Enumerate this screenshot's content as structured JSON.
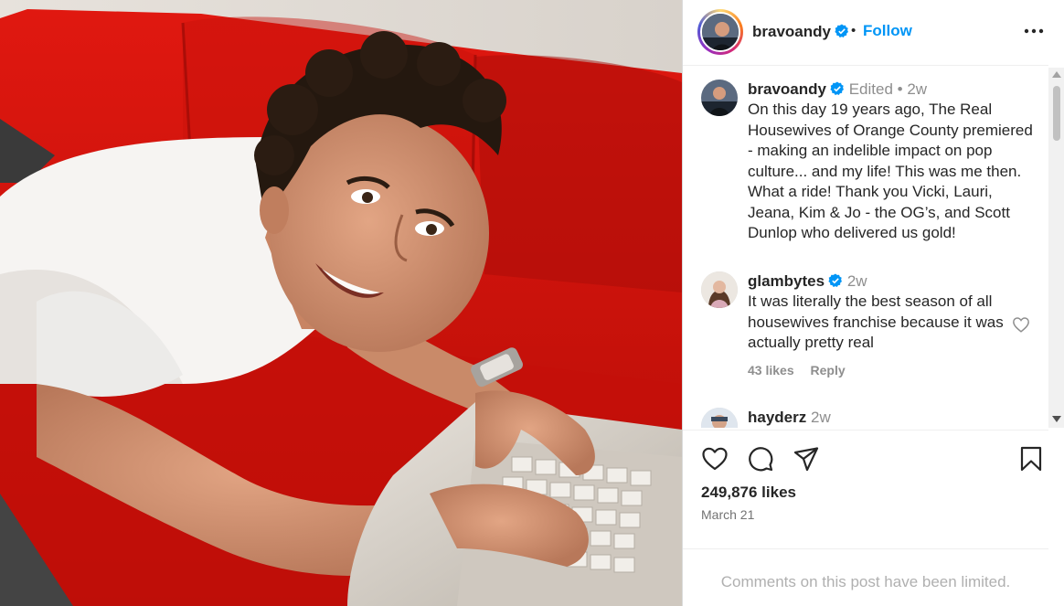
{
  "post": {
    "author": "bravoandy",
    "follow_label": "Follow",
    "separator": "•",
    "more_icon": "more-horizontal-icon"
  },
  "caption": {
    "username": "bravoandy",
    "edited": "Edited",
    "dot": "•",
    "time": "2w",
    "text": "On this day 19 years ago, The Real Housewives of Orange County premiered - making an indelible impact on pop culture... and my life! This was me then. What a ride! Thank you Vicki, Lauri, Jeana, Kim & Jo - the OG’s, and Scott Dunlop who delivered us gold!"
  },
  "comments": [
    {
      "username": "glambytes",
      "time": "2w",
      "text": "It was literally the best season of all housewives franchise because it was actually pretty real",
      "likes": "43 likes",
      "reply": "Reply"
    },
    {
      "username": "hayderz",
      "time": "2w"
    }
  ],
  "actions": {
    "like_icon": "heart-icon",
    "comment_icon": "comment-icon",
    "share_icon": "send-icon",
    "save_icon": "bookmark-icon"
  },
  "likes_count": "249,876 likes",
  "date": "March 21",
  "comments_limited": "Comments on this post have been limited.",
  "colors": {
    "follow_blue": "#0095f6",
    "verified_blue": "#0095f6",
    "couch_red": "#d8140c"
  }
}
